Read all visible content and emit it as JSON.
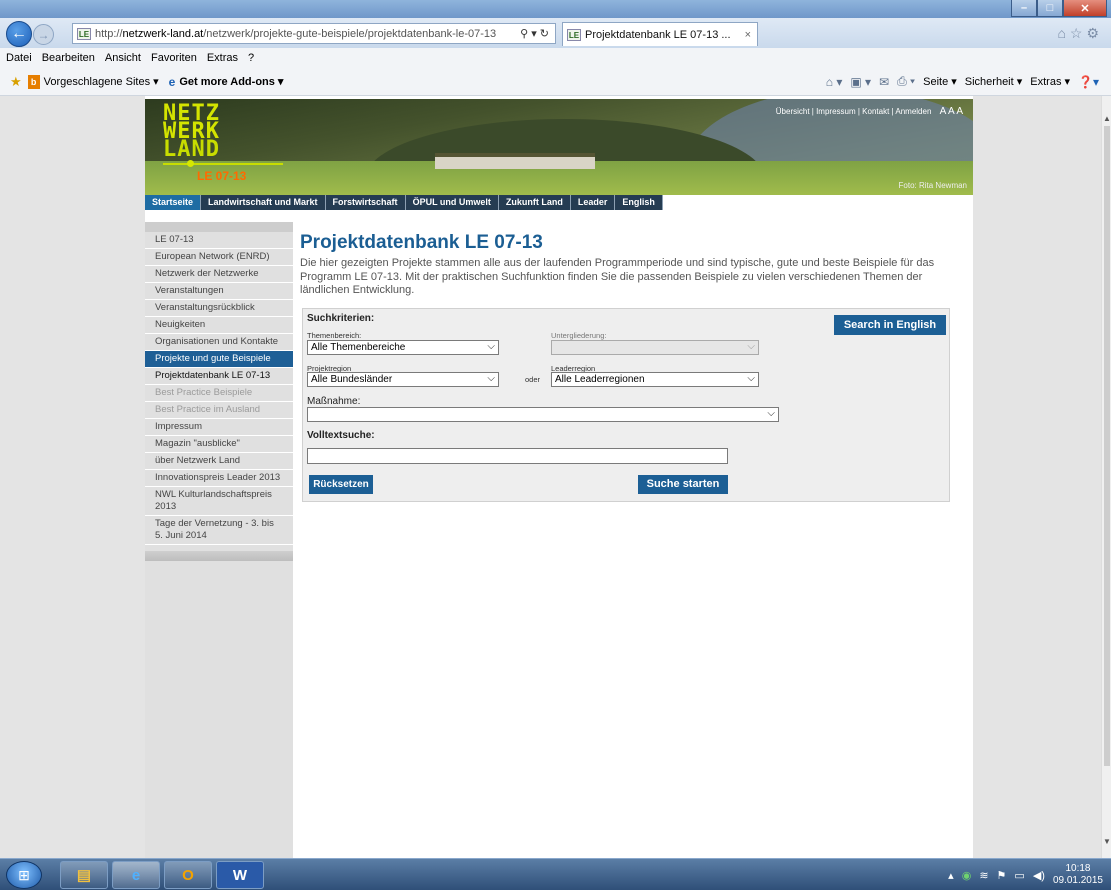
{
  "browser": {
    "url_prefix": "http://",
    "url_domain": "netzwerk-land.at",
    "url_path": "/netzwerk/projekte-gute-beispiele/projektdatenbank-le-07-13",
    "favicon_text": "LE",
    "tab_title": "Projektdatenbank LE 07-13 ...",
    "tab_close": "×",
    "addr_icons": "⚲ ▾ ↻",
    "menu": [
      "Datei",
      "Bearbeiten",
      "Ansicht",
      "Favoriten",
      "Extras",
      "?"
    ],
    "favorites": {
      "suggested": "Vorgeschlagene Sites ▾",
      "addons": "Get more Add-ons ▾",
      "right_items": [
        "Seite ▾",
        "Sicherheit ▾",
        "Extras ▾"
      ]
    }
  },
  "site": {
    "logo": {
      "line1": "NETZ",
      "line2": "WERK",
      "line3": "LAND",
      "sub": "LE 07-13"
    },
    "toplinks": "Übersicht | Impressum | Kontakt | Anmelden",
    "font_sizes": "A A A",
    "photo_credit": "Foto: Rita Newman",
    "mainnav": [
      "Startseite",
      "Landwirtschaft und Markt",
      "Forstwirtschaft",
      "ÖPUL und Umwelt",
      "Zukunft Land",
      "Leader",
      "English"
    ],
    "sidebar": [
      {
        "label": "LE 07-13"
      },
      {
        "label": "European Network (ENRD)"
      },
      {
        "label": "Netzwerk der Netzwerke"
      },
      {
        "label": "Veranstaltungen"
      },
      {
        "label": "Veranstaltungsrückblick"
      },
      {
        "label": "Neuigkeiten"
      },
      {
        "label": "Organisationen und Kontakte"
      },
      {
        "label": "Projekte und gute Beispiele"
      },
      {
        "label": "Projektdatenbank LE 07-13"
      },
      {
        "label": "Best Practice Beispiele"
      },
      {
        "label": "Best Practice im Ausland"
      },
      {
        "label": "Impressum"
      },
      {
        "label": "Magazin \"ausblicke\""
      },
      {
        "label": "über Netzwerk Land"
      },
      {
        "label": "Innovationspreis Leader 2013"
      },
      {
        "label": "NWL Kulturlandschaftspreis 2013"
      },
      {
        "label": "Tage der Vernetzung - 3. bis 5. Juni 2014"
      }
    ],
    "title": "Projektdatenbank LE 07-13",
    "intro": "Die hier gezeigten Projekte stammen alle aus der laufenden Programmperiode und sind typische, gute und beste Beispiele für das Programm LE 07-13. Mit der praktischen Suchfunktion finden Sie die passenden Beispiele zu vielen verschiedenen Themen der ländlichen Entwicklung.",
    "search": {
      "heading": "Suchkriterien:",
      "english_button": "Search in English",
      "themen_label": "Themenbereich:",
      "themen_value": "Alle Themenbereiche",
      "unter_label": "Untergliederung:",
      "unter_value": "",
      "region_label": "Projektregion",
      "region_value": "Alle Bundesländer",
      "oder": "oder",
      "leader_label": "Leaderregion",
      "leader_value": "Alle Leaderregionen",
      "massnahme_label": "Maßnahme:",
      "massnahme_value": "",
      "volltext_label": "Volltextsuche:",
      "reset_button": "Rücksetzen",
      "submit_button": "Suche starten"
    }
  },
  "taskbar": {
    "time": "10:18",
    "date": "09.01.2015"
  }
}
